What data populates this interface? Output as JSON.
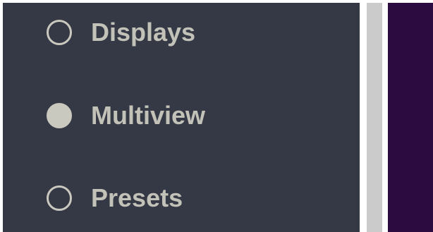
{
  "menu": {
    "items": [
      {
        "label": "Displays",
        "selected": false,
        "icon": "radio-unchecked-icon"
      },
      {
        "label": "Multiview",
        "selected": true,
        "icon": "radio-checked-icon"
      },
      {
        "label": "Presets",
        "selected": false,
        "icon": "radio-unchecked-icon"
      }
    ]
  },
  "colors": {
    "panel_background": "#353845",
    "label_text": "#c2c2b8",
    "radio": "#c9c9bf",
    "scrollbar": "#cbcbcb",
    "right_pane": "#2c0c40"
  }
}
